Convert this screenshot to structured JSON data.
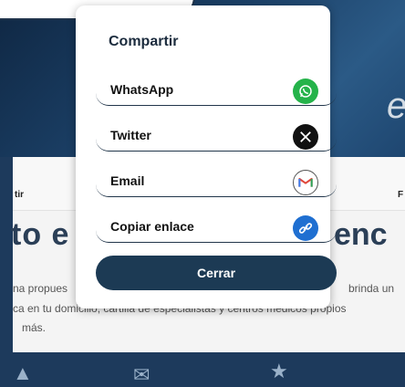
{
  "modal": {
    "title": "Compartir",
    "items": [
      {
        "label": "WhatsApp",
        "icon": "whatsapp-icon"
      },
      {
        "label": "Twitter",
        "icon": "x-twitter-icon"
      },
      {
        "label": "Email",
        "icon": "gmail-icon"
      },
      {
        "label": "Copiar enlace",
        "icon": "link-icon"
      }
    ],
    "close_label": "Cerrar"
  },
  "background": {
    "hero_letter": "e",
    "tab_left": "tir",
    "tab_right": "F",
    "heading_left": "to e",
    "heading_right": "enc",
    "line1_left": "na propues",
    "line1_right": "brinda un",
    "line2": "ca en tu domicilio, cartilla de especialistas y centros médicos propios",
    "line3": "más."
  },
  "colors": {
    "accent": "#1c3a54",
    "whatsapp": "#25b34a",
    "twitter": "#111111",
    "link": "#1f6fd1"
  }
}
